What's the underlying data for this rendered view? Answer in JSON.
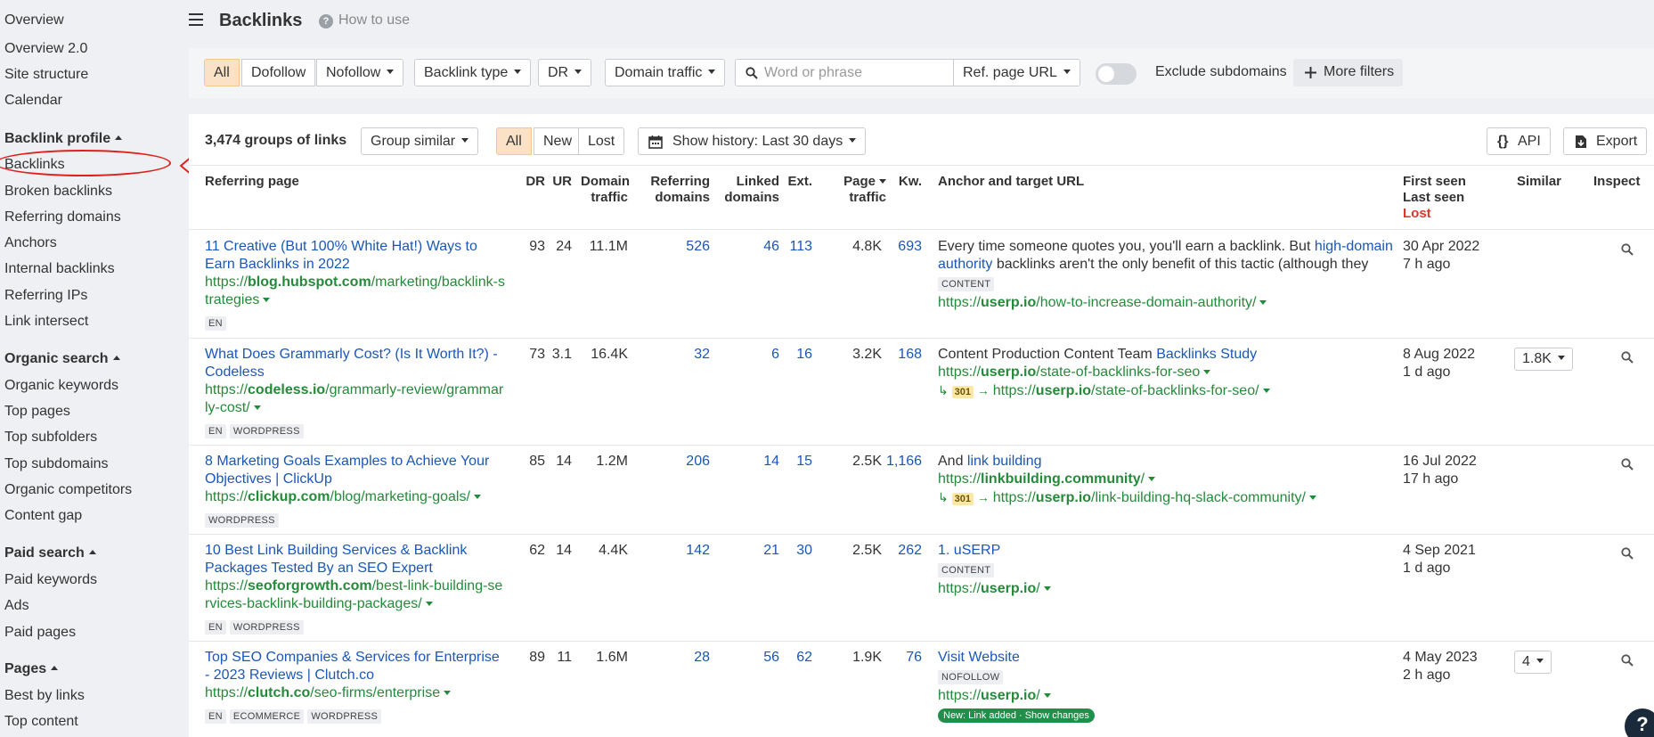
{
  "sidebar": {
    "items_top": [
      "Overview",
      "Overview 2.0",
      "Site structure",
      "Calendar"
    ],
    "backlink_profile": {
      "heading": "Backlink profile",
      "items": [
        "Backlinks",
        "Broken backlinks",
        "Referring domains",
        "Anchors",
        "Internal backlinks",
        "Referring IPs",
        "Link intersect"
      ]
    },
    "organic_search": {
      "heading": "Organic search",
      "items": [
        "Organic keywords",
        "Top pages",
        "Top subfolders",
        "Top subdomains",
        "Organic competitors",
        "Content gap"
      ]
    },
    "paid_search": {
      "heading": "Paid search",
      "items": [
        "Paid keywords",
        "Ads",
        "Paid pages"
      ]
    },
    "pages": {
      "heading": "Pages",
      "items": [
        "Best by links",
        "Top content"
      ]
    }
  },
  "header": {
    "title": "Backlinks",
    "help_label": "How to use"
  },
  "filters": {
    "all": "All",
    "dofollow": "Dofollow",
    "nofollow": "Nofollow",
    "backlink_type": "Backlink type",
    "dr": "DR",
    "domain_traffic": "Domain traffic",
    "search_placeholder": "Word or phrase",
    "ref_page_url": "Ref. page URL",
    "exclude_subdomains": "Exclude subdomains",
    "more_filters": "More filters"
  },
  "toolbar": {
    "count": "3,474 groups of links",
    "group_similar": "Group similar",
    "tab_all": "All",
    "tab_new": "New",
    "tab_lost": "Lost",
    "history": "Show history: Last 30 days",
    "api": "API",
    "export": "Export"
  },
  "columns": {
    "referring_page": "Referring page",
    "dr": "DR",
    "ur": "UR",
    "domain_traffic_1": "Domain",
    "domain_traffic_2": "traffic",
    "referring_domains_1": "Referring",
    "referring_domains_2": "domains",
    "linked_domains_1": "Linked",
    "linked_domains_2": "domains",
    "ext": "Ext.",
    "page_traffic_1": "Page",
    "page_traffic_2": "traffic",
    "kw": "Kw.",
    "anchor": "Anchor and target URL",
    "first_seen": "First seen",
    "last_seen": "Last seen",
    "lost": "Lost",
    "similar": "Similar",
    "inspect": "Inspect"
  },
  "rows": [
    {
      "title_1": "11 Creative (But 100% White Hat!) Ways to",
      "title_2": "Earn Backlinks in 2022",
      "url_prefix": "https://",
      "url_domain": "blog.hubspot.com",
      "url_path_1": "/marketing/backlink-s",
      "url_path_2": "trategies",
      "tags": [
        "EN"
      ],
      "dr": "93",
      "ur": "24",
      "domain_traffic": "11.1M",
      "ref_domains": "526",
      "linked_domains": "46",
      "ext": "113",
      "page_traffic": "4.8K",
      "kw": "693",
      "anchor_1a": "Every time someone quotes you, you'll earn a backlink. But ",
      "anchor_1b": "high-domain",
      "anchor_2a": "authority",
      "anchor_2b": " backlinks aren't the only benefit of this tactic (although they",
      "anchor_tag": "CONTENT",
      "target_prefix": "https://",
      "target_domain": "userp.io",
      "target_path": "/how-to-increase-domain-authority/",
      "first_seen": "30 Apr 2022",
      "last_seen": "7 h ago"
    },
    {
      "title_1": "What Does Grammarly Cost? (Is It Worth It?) -",
      "title_2": "Codeless",
      "url_prefix": "https://",
      "url_domain": "codeless.io",
      "url_path_1": "/grammarly-review/grammar",
      "url_path_2": "ly-cost/",
      "tags": [
        "EN",
        "WORDPRESS"
      ],
      "dr": "73",
      "ur": "3.1",
      "domain_traffic": "16.4K",
      "ref_domains": "32",
      "linked_domains": "6",
      "ext": "16",
      "page_traffic": "3.2K",
      "kw": "168",
      "anchor_text": "Content Production Content Team ",
      "anchor_link": "Backlinks Study",
      "target_prefix": "https://",
      "target_domain": "userp.io",
      "target_path": "/state-of-backlinks-for-seo",
      "redirect_code": "301",
      "redirect_prefix": "https://",
      "redirect_domain": "userp.io",
      "redirect_path": "/state-of-backlinks-for-seo/",
      "first_seen": "8 Aug 2022",
      "last_seen": "1 d ago",
      "similar": "1.8K"
    },
    {
      "title_1": "8 Marketing Goals Examples to Achieve Your",
      "title_2": "Objectives | ClickUp",
      "url_prefix": "https://",
      "url_domain": "clickup.com",
      "url_path_1": "/blog/marketing-goals/",
      "tags": [
        "WORDPRESS"
      ],
      "dr": "85",
      "ur": "14",
      "domain_traffic": "1.2M",
      "ref_domains": "206",
      "linked_domains": "14",
      "ext": "15",
      "page_traffic": "2.5K",
      "kw": "1,166",
      "anchor_text": "And ",
      "anchor_link": "link building",
      "target_prefix": "https://",
      "target_domain": "linkbuilding.community",
      "target_path": "/",
      "redirect_code": "301",
      "redirect_prefix": "https://",
      "redirect_domain": "userp.io",
      "redirect_path": "/link-building-hq-slack-community/",
      "first_seen": "16 Jul 2022",
      "last_seen": "17 h ago"
    },
    {
      "title_1": "10 Best Link Building Services & Backlink",
      "title_2": "Packages Tested By an SEO Expert",
      "url_prefix": "https://",
      "url_domain": "seoforgrowth.com",
      "url_path_1": "/best-link-building-se",
      "url_path_2": "rvices-backlink-building-packages/",
      "tags": [
        "EN",
        "WORDPRESS"
      ],
      "dr": "62",
      "ur": "14",
      "domain_traffic": "4.4K",
      "ref_domains": "142",
      "linked_domains": "21",
      "ext": "30",
      "page_traffic": "2.5K",
      "kw": "262",
      "anchor_link": "1. uSERP",
      "anchor_tag": "CONTENT",
      "target_prefix": "https://",
      "target_domain": "userp.io",
      "target_path": "/",
      "first_seen": "4 Sep 2021",
      "last_seen": "1 d ago"
    },
    {
      "title_1": "Top SEO Companies & Services for Enterprise",
      "title_2": "- 2023 Reviews | Clutch.co",
      "url_prefix": "https://",
      "url_domain": "clutch.co",
      "url_path_1": "/seo-firms/enterprise",
      "tags": [
        "EN",
        "ECOMMERCE",
        "WORDPRESS"
      ],
      "dr": "89",
      "ur": "11",
      "domain_traffic": "1.6M",
      "ref_domains": "28",
      "linked_domains": "56",
      "ext": "62",
      "page_traffic": "1.9K",
      "kw": "76",
      "anchor_link": "Visit Website",
      "anchor_tag": "NOFOLLOW",
      "target_prefix": "https://",
      "target_domain": "userp.io",
      "target_path": "/",
      "badge": "New: Link added · Show changes",
      "first_seen": "4 May 2023",
      "last_seen": "2 h ago",
      "similar": "4"
    }
  ],
  "help_bubble": "?"
}
